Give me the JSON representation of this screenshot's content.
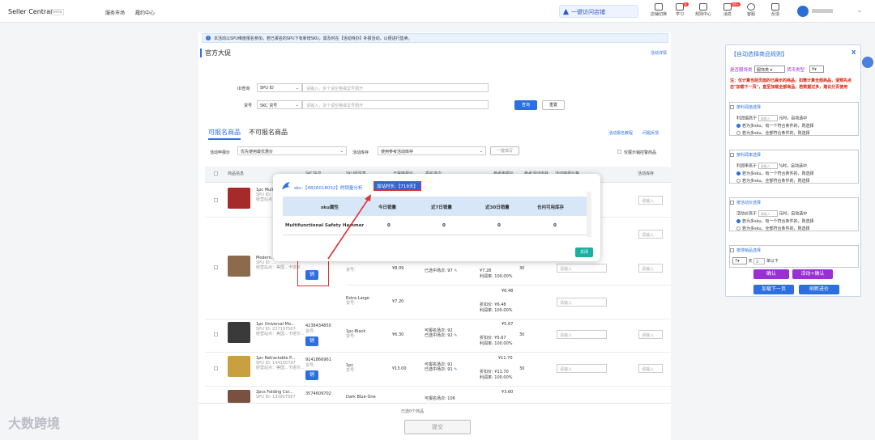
{
  "topbar": {
    "brand": "Seller Central",
    "brand_badge": "beta",
    "nav": [
      "服务市场",
      "履约中心"
    ],
    "visit_store": "一键访问店铺",
    "visit_store_sub": "(官方推荐可用同步)",
    "icons": [
      {
        "name": "shop-manage-icon",
        "label": "店铺切换"
      },
      {
        "name": "learn-icon",
        "label": "学习",
        "badge": "8"
      },
      {
        "name": "rules-icon",
        "label": "规则中心"
      },
      {
        "name": "message-icon",
        "label": "消息",
        "badge": "99+"
      },
      {
        "name": "service-icon",
        "label": "客服"
      },
      {
        "name": "feedback-icon",
        "label": "反馈"
      }
    ]
  },
  "notice": "本活动以SPU维度报名参加，若已报名的SPU下有新增SKU，需及时在【活动待办】补报活动，以便进行售卖。",
  "page_title": "官方大促",
  "activity_link": "活动详情",
  "filters": {
    "id_label": "ID查询",
    "id_type": "SPU ID",
    "id_placeholder": "请输入，多个请空格或逗号隔开",
    "code_label": "货号",
    "code_type": "SKC 货号",
    "code_placeholder": "请输入，多个请空格或逗号隔开",
    "search_btn": "查询",
    "reset_btn": "重置"
  },
  "tabs": [
    "可报名商品",
    "不可报名商品"
  ],
  "tab_links": [
    "活动报名教程",
    "问题反馈"
  ],
  "row_filters": {
    "price_label": "活动申报价",
    "price_value": "优先使用最优惠价",
    "stock_label": "活动库存",
    "stock_value": "使用参考活动库存",
    "fill_btn": "一键填写",
    "only_show": "仅展示销控警商品"
  },
  "table_headers": [
    "商品信息",
    "SKC信息",
    "SKU属性集",
    "日常申报价",
    "报名场次",
    "参考申报价",
    "参考活动库存",
    "活动申报价格",
    "活动库存"
  ],
  "rows": [
    {
      "title": "1pc Mult...",
      "id": "SPU ID: ...",
      "sub": "经营站点：美国...卡塔尔..."
    },
    {
      "title": "Modern...",
      "id": "SPU ID: ...",
      "sub": "经营站点：美国...卡塔尔...",
      "skc_code": "货号:",
      "sku": "",
      "price": "¥8.09",
      "entered": "已选中场次: 97",
      "ref_price": "¥7.28",
      "profit": "利润率: 100.00%",
      "stock": "30"
    },
    {
      "sku": "Extra Large",
      "sku_code": "货号:",
      "price": "¥7.20",
      "ref_price": "¥6.48",
      "ref_price2": "¥6.48",
      "profit": "利润率: 100.00%"
    },
    {
      "title": "1pc Universal Mo...",
      "id": "SPU ID: 237197567",
      "sub": "经营站点：美国...卡塔尔...",
      "skc": "4238434850",
      "skc_code": "货号:",
      "sku": "1pc-Black",
      "sku_code": "货号:",
      "price": "¥6.30",
      "avail": "可报名场次: 92",
      "entered": "已选中场次: 92",
      "ref_price": "¥5.67",
      "ref_price2": "¥5.67",
      "profit": "利润率: 100.00%",
      "stock": "30"
    },
    {
      "title": "1pc Retractable P...",
      "id": "SPU ID: 144150797",
      "sub": "经营站点：美国...卡塔尔...",
      "skc": "9141866961",
      "skc_code": "货号:",
      "sku": "1pc",
      "sku_code": "货号:",
      "price": "¥13.00",
      "avail": "可报名场次: 91",
      "entered": "已选中场次: 91",
      "ref_price": "¥11.70",
      "ref_price2": "¥11.70",
      "profit": "利润率: 100.00%",
      "stock": "30"
    },
    {
      "title": "2pcs Folding Col...",
      "id": "SPU ID: 133907567",
      "skc": "3574609702",
      "sku": "Dark Blue-One",
      "avail": "可报名场次: 106",
      "ref_price": "¥3.60"
    }
  ],
  "input_placeholder": "请输入",
  "sales_btn": "销",
  "selected_count": "已选0个商品",
  "submit_btn": "提交",
  "popup": {
    "head": "skc:【4826018032】的销量分析",
    "highlight": "加站时长:【719天】",
    "columns": [
      "sku属性",
      "今日销量",
      "近7日销量",
      "近30日销量",
      "仓内可用库存"
    ],
    "row": [
      "Multifunctional Safety Hammer",
      "0",
      "0",
      "0",
      "0"
    ],
    "close": "关闭"
  },
  "panel": {
    "title": "【自动选择商品规则】",
    "close": "X",
    "q1": "是否服饰类",
    "q1_val": "服饰类",
    "q2": "货币类型",
    "q2_val": "¥",
    "note": "注：仅计算当前页面的已展示的商品，如需计算全部商品，请预先点击\"加载下一页\"，直至加载全部商品，若数据过多，建议分页使用",
    "sections": [
      {
        "title": "按利润值选择",
        "line": "利润值高于",
        "unit": "元时，自动选中",
        "placeholder": "请输入",
        "opt_a": "若为多sku，有一个符合条件的，则选择",
        "opt_b": "若为多sku，全部符合条件的，则选择"
      },
      {
        "title": "按利润率选择",
        "line": "利润率高于",
        "unit": "%时，自动选中",
        "placeholder": "请输入",
        "opt_a": "若为多sku，有一个符合条件的，则选择",
        "opt_b": "若为多sku，全部符合条件的，则选择"
      },
      {
        "title": "按活动价选择",
        "line": "活动价高于",
        "unit": "元时，自动选中",
        "placeholder": "请输入",
        "opt_a": "若为多sku，有一个符合条件的，则选择",
        "opt_b": "若为多sku，全部符合条件的，则选择"
      }
    ],
    "sales_section": "按滞销品选择",
    "days": "7",
    "days_unit": "天",
    "qty": "3",
    "qty_unit": "单以下",
    "confirm": "确认",
    "activity_confirm": "活动+确认",
    "load_next": "加载下一页",
    "refresh": "刷新进价"
  },
  "watermark": "大数跨境",
  "colors": {
    "accent": "#2d6fe0",
    "danger": "#e03030",
    "panel_red": "#d81e06",
    "purple": "#9a2fd6"
  }
}
